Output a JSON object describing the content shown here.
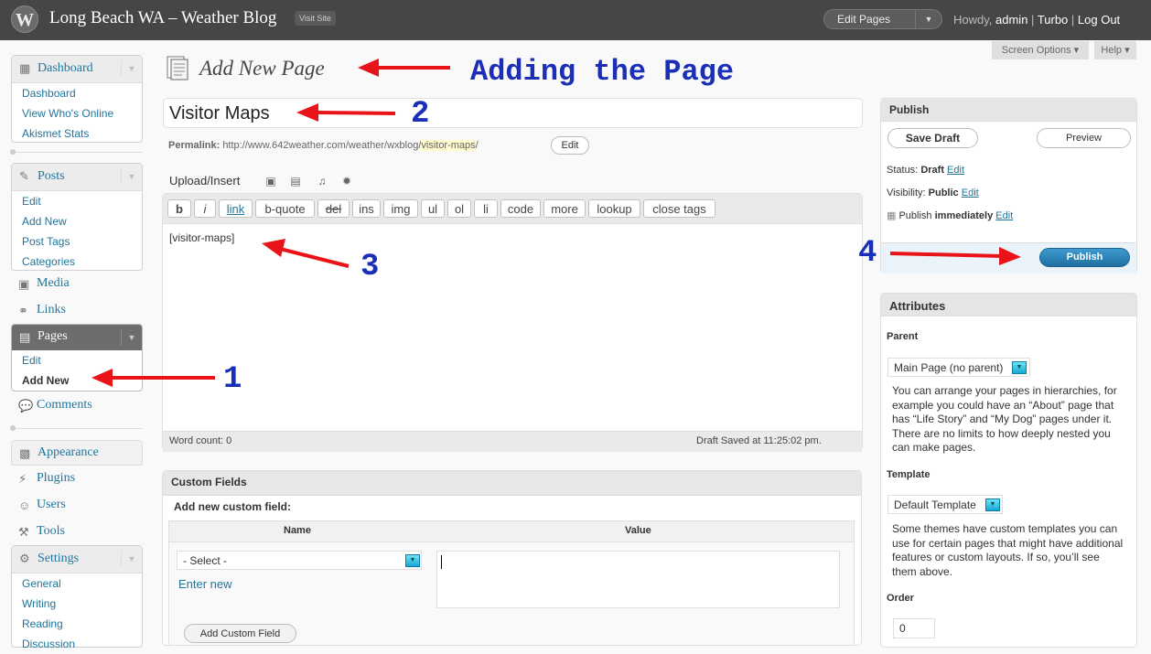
{
  "header": {
    "logo": "W",
    "site_title": "Long Beach WA – Weather Blog",
    "visit_site": "Visit Site",
    "favorite_action": "Edit Pages",
    "howdy": "Howdy,",
    "user": "admin",
    "links": [
      "Turbo",
      "Log Out"
    ]
  },
  "tabs": {
    "screen_options": "Screen Options ▾",
    "help": "Help ▾"
  },
  "sidebar": {
    "dashboard": {
      "label": "Dashboard",
      "items": [
        "Dashboard",
        "View Who's Online",
        "Akismet Stats"
      ]
    },
    "posts": {
      "label": "Posts",
      "items": [
        "Edit",
        "Add New",
        "Post Tags",
        "Categories"
      ]
    },
    "media": "Media",
    "links": "Links",
    "pages": {
      "label": "Pages",
      "items": [
        "Edit",
        "Add New"
      ]
    },
    "comments": "Comments",
    "appearance": "Appearance",
    "plugins": "Plugins",
    "users": "Users",
    "tools": "Tools",
    "settings": {
      "label": "Settings",
      "items": [
        "General",
        "Writing",
        "Reading",
        "Discussion"
      ]
    }
  },
  "main": {
    "heading": "Add New Page",
    "title_value": "Visitor Maps",
    "permalink_label": "Permalink:",
    "permalink_url": "http://www.642weather.com/weather/wxblog/",
    "permalink_slug": "visitor-maps",
    "permalink_trail": "/",
    "permalink_edit": "Edit",
    "upload_insert": "Upload/Insert",
    "toolbar": [
      "b",
      "i",
      "link",
      "b-quote",
      "del",
      "ins",
      "img",
      "ul",
      "ol",
      "li",
      "code",
      "more",
      "lookup",
      "close tags"
    ],
    "content": "[visitor-maps]",
    "word_count": "Word count: 0",
    "draft_saved": "Draft Saved at 11:25:02 pm."
  },
  "custom_fields": {
    "title": "Custom Fields",
    "add_new_label": "Add new custom field:",
    "name_header": "Name",
    "value_header": "Value",
    "select_label": "- Select -",
    "enter_new": "Enter new",
    "add_button": "Add Custom Field"
  },
  "publish": {
    "title": "Publish",
    "save_draft": "Save Draft",
    "preview": "Preview",
    "status_label": "Status:",
    "status_value": "Draft",
    "visibility_label": "Visibility:",
    "visibility_value": "Public",
    "publish_label": "Publish",
    "publish_value": "immediately",
    "edit": "Edit",
    "publish_button": "Publish"
  },
  "attributes": {
    "title": "Attributes",
    "parent_label": "Parent",
    "parent_value": "Main Page (no parent)",
    "parent_help": "You can arrange your pages in hierarchies, for example you could have an “About” page that has “Life Story” and “My Dog” pages under it. There are no limits to how deeply nested you can make pages.",
    "template_label": "Template",
    "template_value": "Default Template",
    "template_help": "Some themes have custom templates you can use for certain pages that might have additional features or custom layouts. If so, you’ll see them above.",
    "order_label": "Order",
    "order_value": "0"
  },
  "annotations": {
    "adding": "Adding the Page",
    "n1": "1",
    "n2": "2",
    "n3": "3",
    "n4": "4",
    "arrow_color": "#e8141a",
    "text_color": "#1a2fb5"
  }
}
